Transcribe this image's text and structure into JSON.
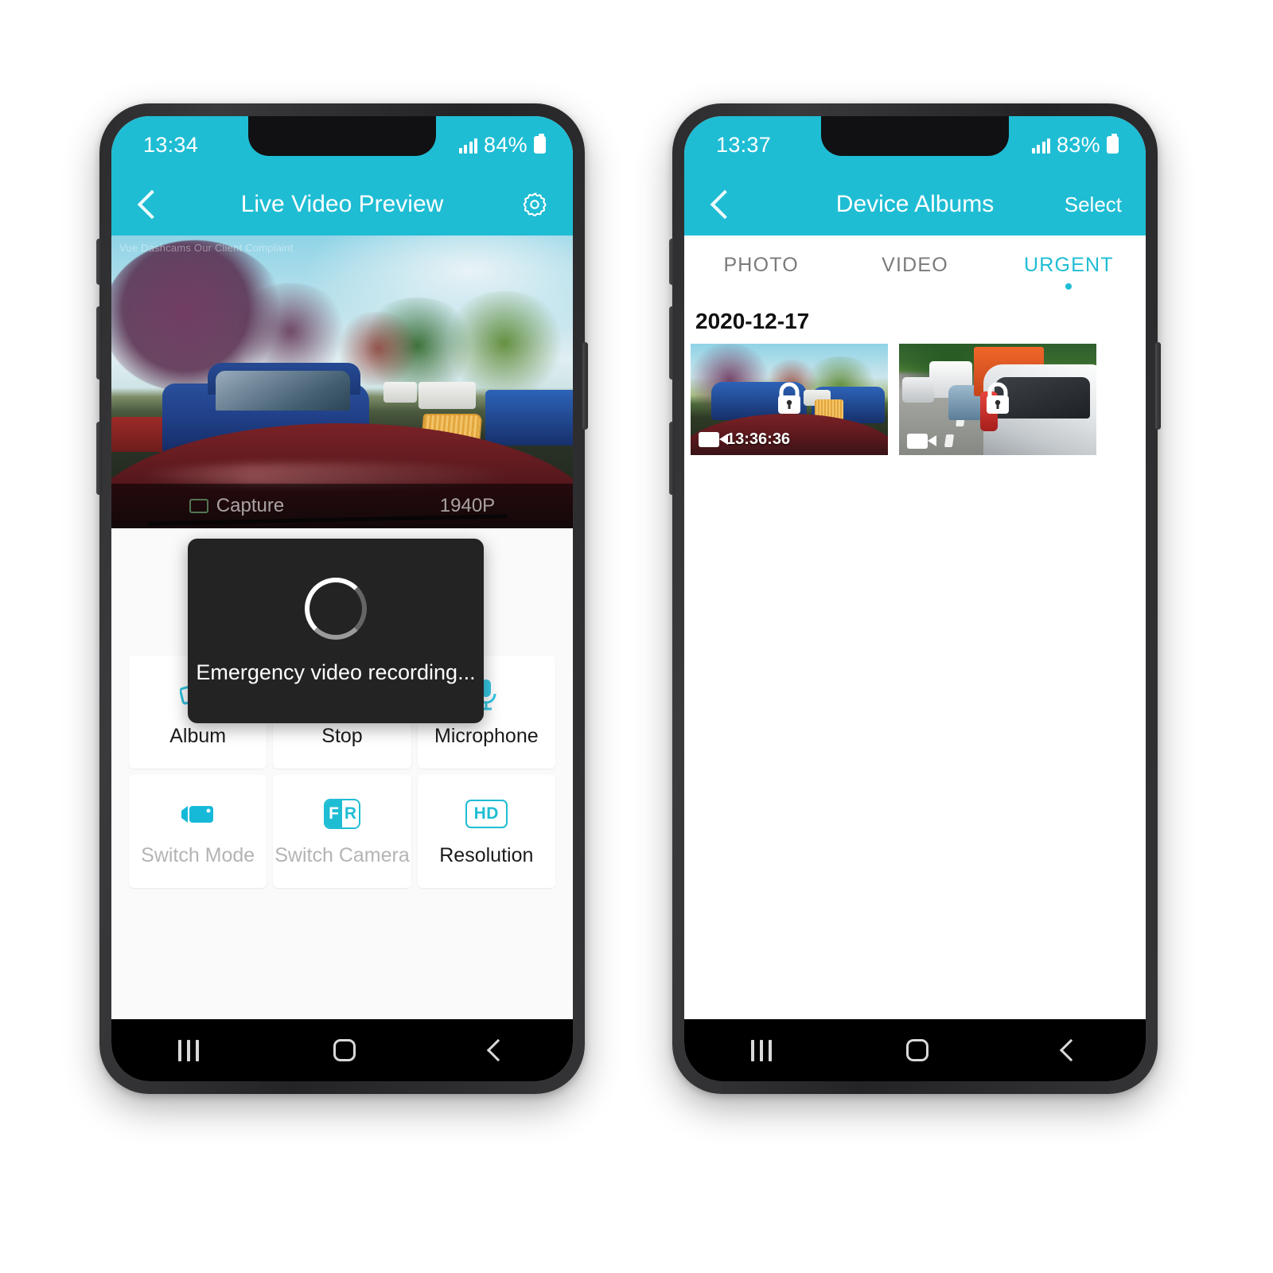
{
  "theme": {
    "teal": "#1fbdd4",
    "record_red": "#e11b22",
    "toast_bg": "#232323"
  },
  "phone_left": {
    "status": {
      "time": "13:34",
      "battery": "84%",
      "signal_icon": "signal-bars-icon",
      "battery_icon": "battery-icon"
    },
    "appbar": {
      "back_icon": "chevron-left-icon",
      "title": "Live Video Preview",
      "settings_icon": "gear-icon"
    },
    "video": {
      "watermark": "Vue Dashcams Our Client Complaint",
      "toolbar": {
        "capture_label": "Capture",
        "resolution_label": "1940P"
      }
    },
    "toast": {
      "spinner_icon": "loading-spinner-icon",
      "message": "Emergency video recording..."
    },
    "tiles": [
      {
        "label": "Album",
        "icon": "photo-stack-icon",
        "disabled": false
      },
      {
        "label": "Stop",
        "icon": "record-stop-icon",
        "disabled": false
      },
      {
        "label": "Microphone",
        "icon": "microphone-icon",
        "disabled": false
      },
      {
        "label": "Switch Mode",
        "icon": "camcorder-icon",
        "disabled": true
      },
      {
        "label": "Switch Camera",
        "icon": "front-rear-icon",
        "disabled": true
      },
      {
        "label": "Resolution",
        "icon": "hd-badge-icon",
        "disabled": false
      }
    ],
    "nav": {
      "recents": "recents-icon",
      "home": "home-icon",
      "back": "back-icon"
    }
  },
  "phone_right": {
    "status": {
      "time": "13:37",
      "battery": "83%",
      "signal_icon": "signal-bars-icon",
      "battery_icon": "battery-icon"
    },
    "appbar": {
      "back_icon": "chevron-left-icon",
      "title": "Device Albums",
      "select_label": "Select"
    },
    "tabs": [
      {
        "label": "PHOTO",
        "active": false
      },
      {
        "label": "VIDEO",
        "active": false
      },
      {
        "label": "URGENT",
        "active": true
      }
    ],
    "section_date": "2020-12-17",
    "thumbnails": [
      {
        "lock_icon": "lock-icon",
        "video_icon": "video-camera-icon",
        "timestamp": "13:36:36",
        "scene": "parking-lot"
      },
      {
        "lock_icon": "lock-icon",
        "video_icon": "video-camera-icon",
        "timestamp": "",
        "scene": "road-traffic"
      }
    ],
    "nav": {
      "recents": "recents-icon",
      "home": "home-icon",
      "back": "back-icon"
    }
  }
}
